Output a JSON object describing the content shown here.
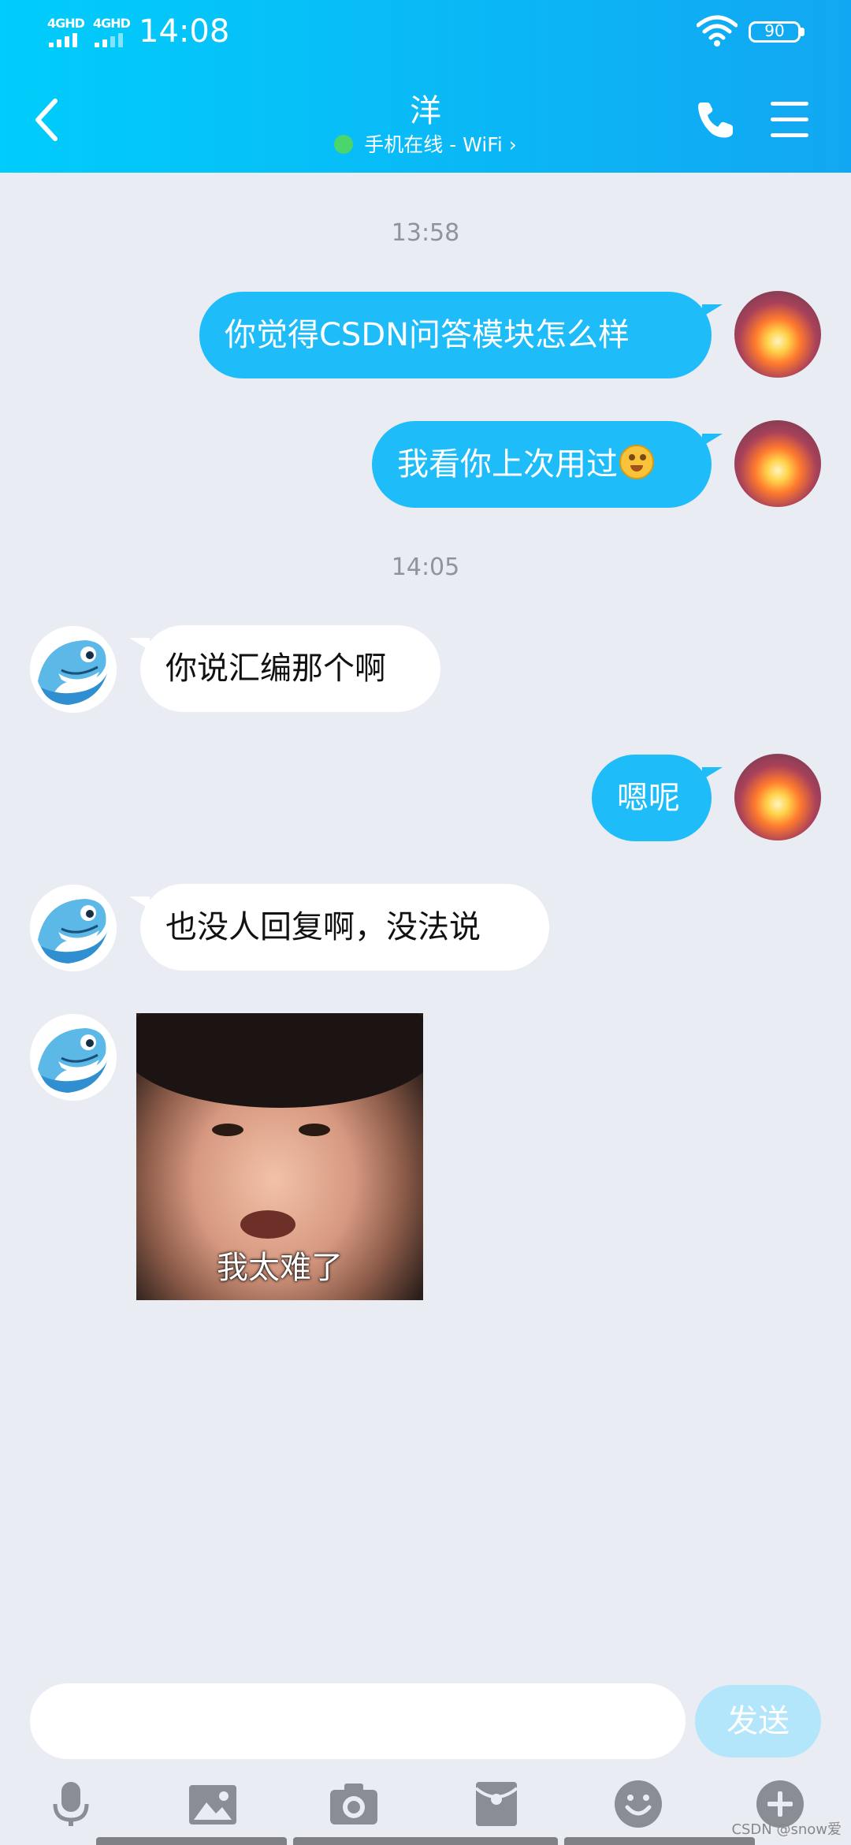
{
  "status_bar": {
    "signal_1": "4GHD",
    "signal_2": "4GHD",
    "time": "14:08",
    "battery": "90"
  },
  "header": {
    "back_icon": "back-arrow-icon",
    "contact_name": "洋",
    "status_text": "手机在线 - WiFi",
    "status_chevron": "›",
    "online_color": "#4ad66d",
    "phone_icon": "phone-icon",
    "menu_icon": "menu-icon"
  },
  "chat": {
    "timestamps": [
      "13:58",
      "14:05"
    ],
    "messages": [
      {
        "from": "me",
        "text": "你觉得CSDN问答模块怎么样"
      },
      {
        "from": "me",
        "text": "我看你上次用过",
        "emoji": "laughing-face-emoji"
      },
      {
        "from": "contact",
        "text": "你说汇编那个啊"
      },
      {
        "from": "me",
        "text": "嗯呢"
      },
      {
        "from": "contact",
        "text": "也没人回复啊，没法说"
      },
      {
        "from": "contact",
        "type": "sticker",
        "caption": "我太难了"
      }
    ]
  },
  "input": {
    "value": "",
    "placeholder": "",
    "send_label": "发送"
  },
  "toolbar": {
    "icons": [
      "microphone-icon",
      "image-icon",
      "camera-icon",
      "red-packet-icon",
      "emoji-icon",
      "plus-icon"
    ]
  },
  "watermark": "CSDN @snow爱",
  "colors": {
    "header_start": "#00cdfb",
    "header_end": "#12a7f2",
    "bubble_out": "#1ebcf9",
    "bubble_in": "#ffffff",
    "background": "#e9ecf3",
    "send_disabled": "#b4e6fb",
    "toolbar_icon": "#8a8d93"
  }
}
